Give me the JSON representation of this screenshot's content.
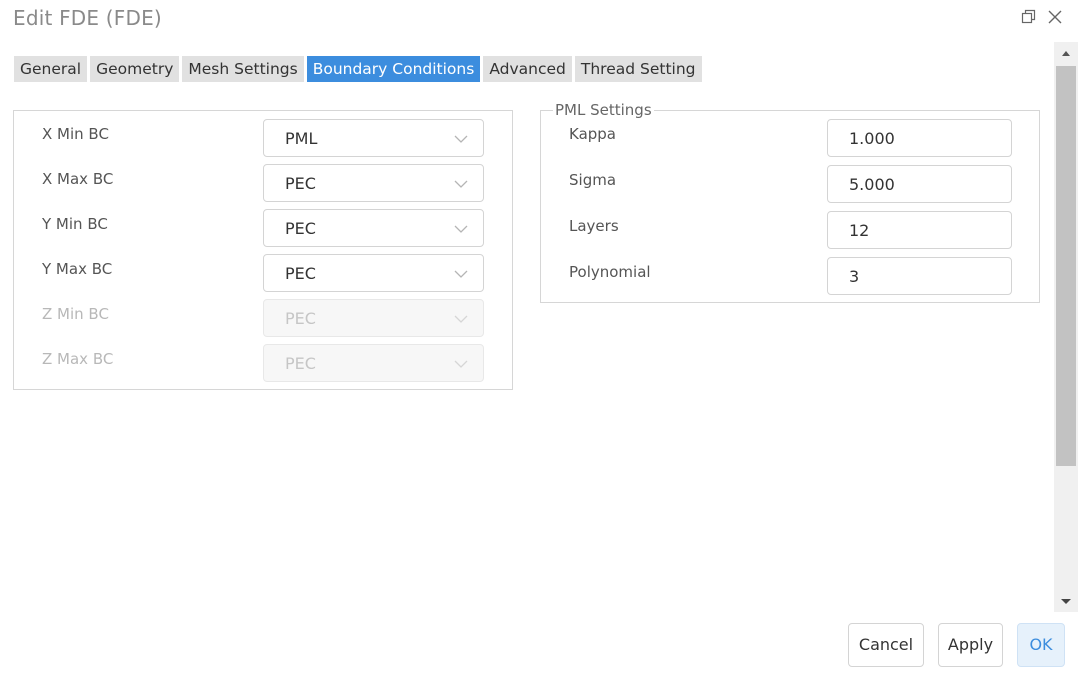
{
  "window": {
    "title": "Edit FDE (FDE)",
    "icons": [
      "restore-icon",
      "close-icon"
    ]
  },
  "tabs": [
    {
      "label": "General",
      "active": false
    },
    {
      "label": "Geometry",
      "active": false
    },
    {
      "label": "Mesh Settings",
      "active": false
    },
    {
      "label": "Boundary Conditions",
      "active": true
    },
    {
      "label": "Advanced",
      "active": false
    },
    {
      "label": "Thread Setting",
      "active": false
    }
  ],
  "boundary_conditions": [
    {
      "label": "X Min BC",
      "value": "PML",
      "disabled": false
    },
    {
      "label": "X Max BC",
      "value": "PEC",
      "disabled": false
    },
    {
      "label": "Y Min BC",
      "value": "PEC",
      "disabled": false
    },
    {
      "label": "Y Max BC",
      "value": "PEC",
      "disabled": false
    },
    {
      "label": "Z Min BC",
      "value": "PEC",
      "disabled": true
    },
    {
      "label": "Z Max BC",
      "value": "PEC",
      "disabled": true
    }
  ],
  "pml_settings": {
    "legend": "PML Settings",
    "fields": [
      {
        "label": "Kappa",
        "value": "1.000"
      },
      {
        "label": "Sigma",
        "value": "5.000"
      },
      {
        "label": "Layers",
        "value": "12"
      },
      {
        "label": "Polynomial",
        "value": "3"
      }
    ]
  },
  "footer": {
    "cancel_label": "Cancel",
    "apply_label": "Apply",
    "ok_label": "OK"
  },
  "colors": {
    "accent": "#3c8dde",
    "tab_inactive": "#e1e1e1",
    "ok_button_bg": "#e6f1fb"
  }
}
